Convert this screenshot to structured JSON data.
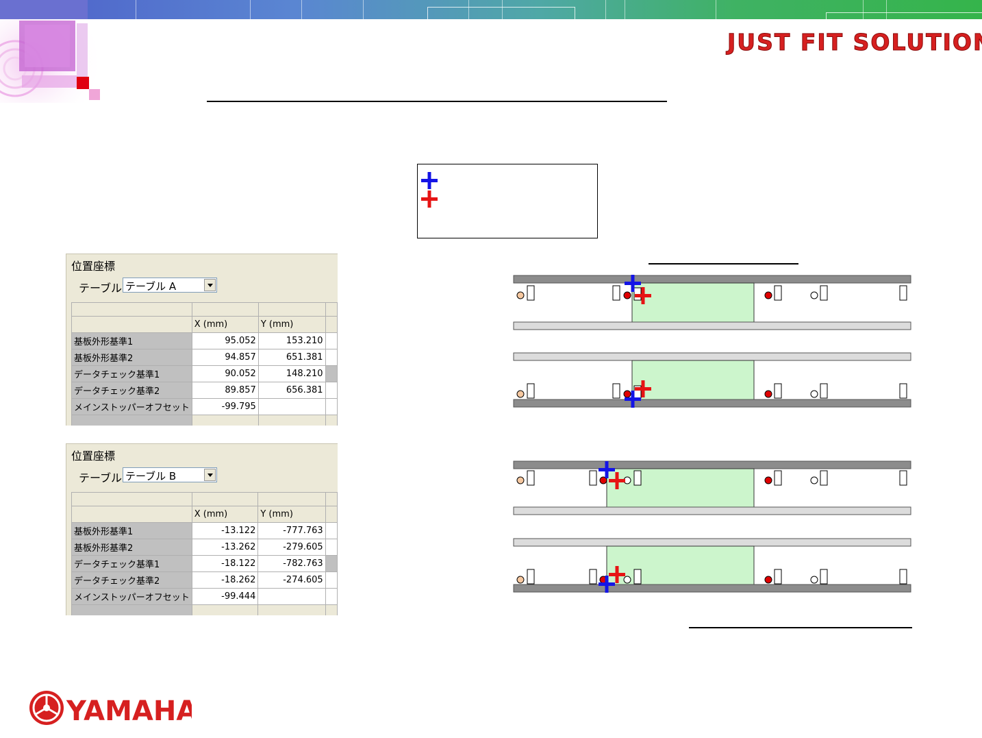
{
  "header": {
    "brand_slogan": "JUST FIT SOLUTION",
    "brand_color": "#d62020",
    "band_colors": [
      "#4d5fc9",
      "#4fa8a6",
      "#35b44b"
    ]
  },
  "legend": {
    "items": [
      {
        "icon": "blue-cross-icon",
        "color": "#1414e6"
      },
      {
        "icon": "red-cross-icon",
        "color": "#e61414"
      }
    ]
  },
  "panels": [
    {
      "title": "位置座標",
      "table_label": "テーブル",
      "select_value": "テーブル A",
      "col_x": "X (mm)",
      "col_y": "Y (mm)",
      "rows": [
        {
          "label": "基板外形基準1",
          "x": "95.052",
          "y": "153.210"
        },
        {
          "label": "基板外形基準2",
          "x": "94.857",
          "y": "651.381"
        },
        {
          "label": "データチェック基準1",
          "x": "90.052",
          "y": "148.210"
        },
        {
          "label": "データチェック基準2",
          "x": "89.857",
          "y": "656.381"
        },
        {
          "label": "メインストッパーオフセット",
          "x": "-99.795",
          "y": ""
        }
      ]
    },
    {
      "title": "位置座標",
      "table_label": "テーブル",
      "select_value": "テーブル B",
      "col_x": "X (mm)",
      "col_y": "Y (mm)",
      "rows": [
        {
          "label": "基板外形基準1",
          "x": "-13.122",
          "y": "-777.763"
        },
        {
          "label": "基板外形基準2",
          "x": "-13.262",
          "y": "-279.605"
        },
        {
          "label": "データチェック基準1",
          "x": "-18.122",
          "y": "-782.763"
        },
        {
          "label": "データチェック基準2",
          "x": "-18.262",
          "y": "-274.605"
        },
        {
          "label": "メインストッパーオフセット",
          "x": "-99.444",
          "y": ""
        }
      ]
    }
  ],
  "footer": {
    "company_logo": "YAMAHA",
    "logo_color": "#d62020"
  },
  "diagram_colors": {
    "rail_dark": "#8c8c8c",
    "rail_light": "#dcdcdc",
    "board_fill": "#ccf5cc",
    "sensor_red": "#e00000",
    "sensor_orange": "#f6c8a0"
  }
}
